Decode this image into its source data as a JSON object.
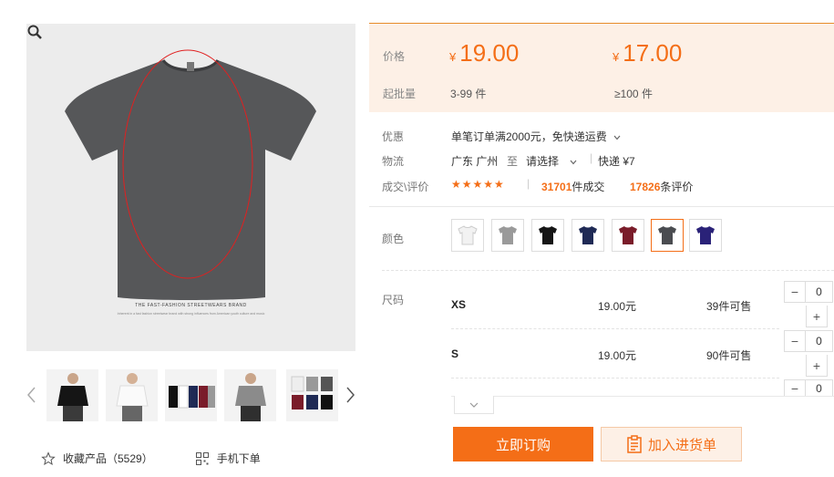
{
  "product": {
    "brand_text": "THE FAST-FASHION STREETWEARS BRAND",
    "brand_sub": "Inherent in a fast fashion streetwear brand with strong influences from American youth culture and music"
  },
  "gallery": {
    "icons": {
      "zoom": "zoom-icon",
      "prev": "chevron-left-icon",
      "next": "chevron-right-icon"
    },
    "thumbs": [
      "model-black-tee",
      "model-white-tee",
      "folded-tees",
      "model-gray-tee",
      "color-grid"
    ]
  },
  "links": {
    "favorite_label": "收藏产品（5529）",
    "mobile_label": "手机下单"
  },
  "price": {
    "label": "价格",
    "tier1_currency": "¥",
    "tier1_price": "19.00",
    "tier2_currency": "¥",
    "tier2_price": "17.00",
    "moq_label": "起批量",
    "tier1_range": "3-99 件",
    "tier2_range": "≥100 件"
  },
  "promo": {
    "label": "优惠",
    "text": "单笔订单满2000元，免快递运费"
  },
  "shipping": {
    "label": "物流",
    "from": "广东 广州",
    "to_word": "至",
    "dest_placeholder": "请选择",
    "express": "快递 ¥7"
  },
  "deals": {
    "label": "成交\\评价",
    "stars": "★★★★★",
    "sales_count": "31701",
    "sales_unit": "件成交",
    "review_count": "17826",
    "review_unit": "条评价"
  },
  "colors": {
    "label": "颜色",
    "swatches": [
      {
        "name": "white",
        "hex": "#f2f2f2"
      },
      {
        "name": "light-gray",
        "hex": "#9a9a9a"
      },
      {
        "name": "black",
        "hex": "#151515"
      },
      {
        "name": "navy",
        "hex": "#1f2a55"
      },
      {
        "name": "burgundy",
        "hex": "#7a1c2a"
      },
      {
        "name": "charcoal",
        "hex": "#4a4c50"
      },
      {
        "name": "royal-blue",
        "hex": "#2a2278"
      }
    ],
    "selected": "charcoal"
  },
  "sizes": {
    "label": "尺码",
    "rows": [
      {
        "name": "XS",
        "price": "19.00元",
        "stock": "39件可售",
        "qty": "0"
      },
      {
        "name": "S",
        "price": "19.00元",
        "stock": "90件可售",
        "qty": "0"
      },
      {
        "name": "",
        "price": "",
        "stock": "",
        "qty": "0"
      }
    ]
  },
  "actions": {
    "buy_label": "立即订购",
    "cart_label": "加入进货单"
  },
  "colors_theme": {
    "accent": "#f46e17",
    "panel_bg": "#fdf0e6"
  }
}
